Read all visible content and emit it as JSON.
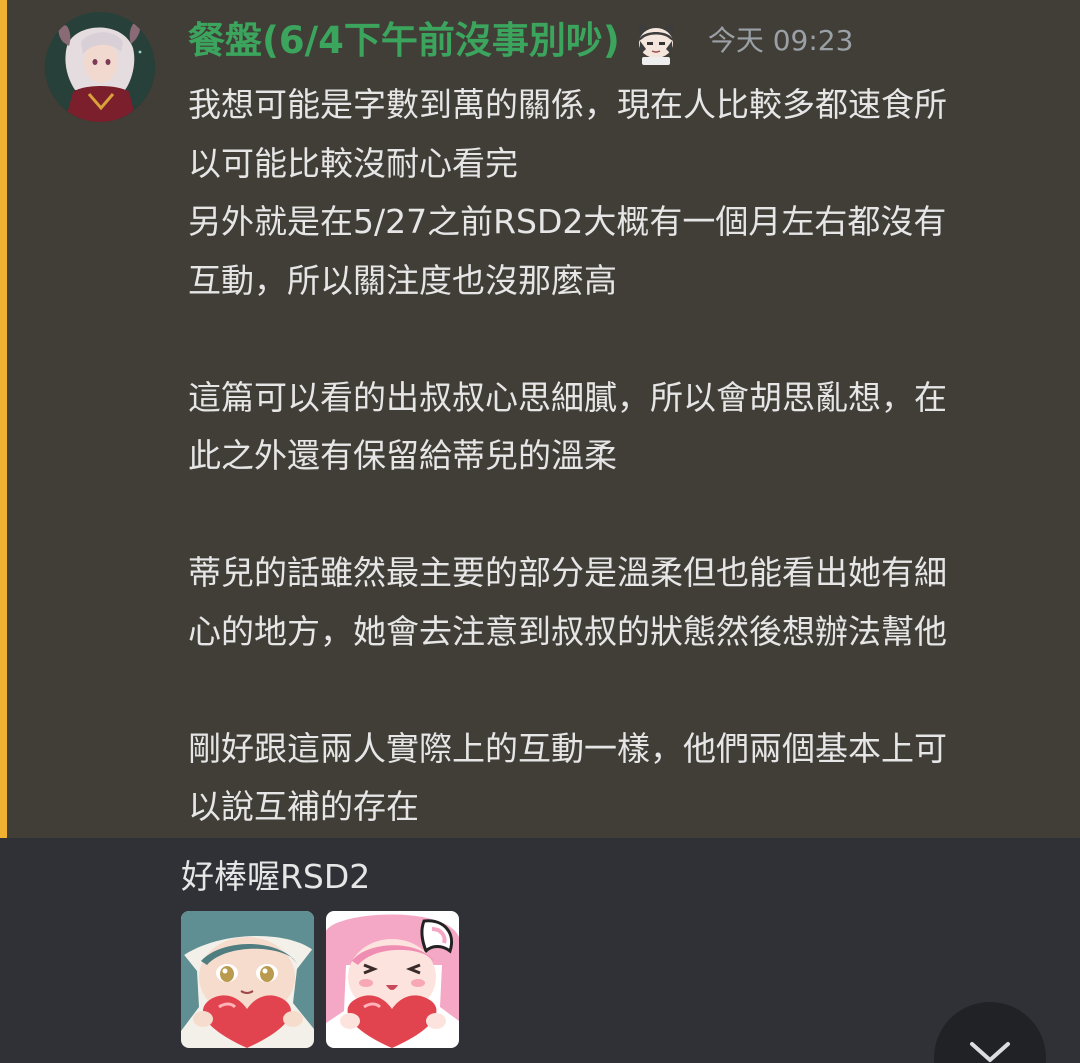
{
  "message": {
    "author": "餐盤(6/4下午前沒事別吵)",
    "author_color": "#3ba55d",
    "author_emoji": "cat-ear-girl-emoji",
    "timestamp": "今天 09:23",
    "highlight_color": "#f0b132",
    "paragraphs": [
      "我想可能是字數到萬的關係，現在人比較多都速食所\n以可能比較沒耐心看完\n另外就是在5/27之前RSD2大概有一個月左右都沒有\n互動，所以關注度也沒那麼高",
      "這篇可以看的出叔叔心思細膩，所以會胡思亂想，在\n此之外還有保留給蒂兒的溫柔",
      "蒂兒的話雖然最主要的部分是溫柔但也能看出她有細\n心的地方，她會去注意到叔叔的狀態然後想辦法幫他",
      "剛好跟這兩人實際上的互動一樣，他們兩個基本上可\n以說互補的存在"
    ]
  },
  "followup": {
    "text": "好棒喔RSD2",
    "stickers": [
      "teal-hair-heart-sticker",
      "pink-hair-heart-sticker"
    ]
  },
  "scroll_button": {
    "icon": "chevron-down-icon"
  }
}
